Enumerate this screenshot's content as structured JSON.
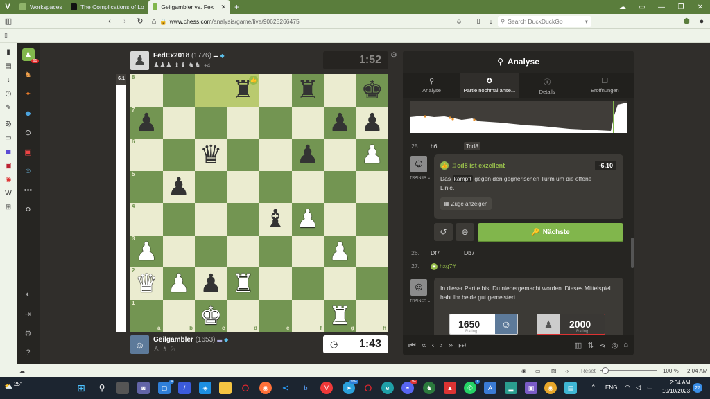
{
  "browser": {
    "tabs": [
      {
        "label": "Workspaces",
        "active": false
      },
      {
        "label": "The Complications of Long",
        "active": false
      },
      {
        "label": "Geilgambler vs. FexEx2018",
        "active": true
      }
    ],
    "url_host": "www.chess.com",
    "url_path": "/analysis/game/live/90625266475",
    "search_placeholder": "Search DuckDuckGo",
    "zoom_reset": "Reset",
    "zoom_value": "100 %",
    "zoom_level": 0.1,
    "status_time": "2:04 AM"
  },
  "nav": {
    "notification_count": "61"
  },
  "game": {
    "top_player": {
      "name": "FedEx2018",
      "rating": "(1776)",
      "captured": "♟♟♟ ♝♝ ♞♞",
      "advantage": "+4",
      "clock": "1:52"
    },
    "bottom_player": {
      "name": "Geilgambler",
      "rating": "(1653)",
      "captured": "♙ ♗ ♘",
      "clock": "1:43"
    },
    "eval_bar": {
      "label": "6.1",
      "white_fraction": 0.96
    },
    "files": [
      "a",
      "b",
      "c",
      "d",
      "e",
      "f",
      "g",
      "h"
    ],
    "ranks": [
      "8",
      "7",
      "6",
      "5",
      "4",
      "3",
      "2",
      "1"
    ],
    "board": [
      [
        "",
        "",
        "",
        "bR",
        "",
        "bR",
        "",
        "bK"
      ],
      [
        "bP",
        "",
        "",
        "",
        "",
        "",
        "bP",
        "bP"
      ],
      [
        "",
        "",
        "bQ",
        "",
        "",
        "bP",
        "",
        "wP"
      ],
      [
        "",
        "bP",
        "",
        "",
        "",
        "",
        "",
        ""
      ],
      [
        "",
        "",
        "",
        "",
        "bB",
        "wP",
        "",
        ""
      ],
      [
        "wP",
        "",
        "",
        "",
        "",
        "",
        "wP",
        ""
      ],
      [
        "wQ",
        "wP",
        "bP",
        "wR",
        "",
        "",
        "",
        ""
      ],
      [
        "",
        "",
        "wK",
        "",
        "",
        "",
        "wR",
        ""
      ]
    ],
    "highlight": [
      [
        0,
        2
      ],
      [
        0,
        3
      ]
    ],
    "badge_square": [
      0,
      3
    ]
  },
  "analysis": {
    "title": "Analyse",
    "tabs": [
      "Analyse",
      "Partie nochmal anse...",
      "Details",
      "Eröffnungen"
    ],
    "active_tab": 1,
    "moves": [
      {
        "num": "25.",
        "white": "h6",
        "black": "Tcd8"
      },
      {
        "num": "26.",
        "white": "Df7",
        "black": "Db7"
      },
      {
        "num": "27.",
        "white": "hxg7#",
        "black": ""
      }
    ],
    "coach_label": "TRAINER ⌄",
    "feedback": {
      "move_text": "♖cd8 ist exzellent",
      "score": "-6.10",
      "text_before": "Das",
      "keyword": "kämpft",
      "text_after": "gegen den gegnerischen Turm um die offene Linie.",
      "show_moves": "Züge anzeigen"
    },
    "next_button": "Nächste",
    "summary": "In dieser Partie bist Du niedergemacht worden. Dieses Mittelspiel habt Ihr beide gut gemeistert.",
    "ratings": [
      {
        "value": "1650",
        "label": "Rating"
      },
      {
        "value": "2000",
        "label": "Rating"
      }
    ]
  },
  "taskbar": {
    "weather": "25°",
    "lang": "ENG",
    "time": "2:04 AM",
    "date": "10/10/2023",
    "notif": "27",
    "badges": {
      "whatsapp": "4",
      "telegram": "99+",
      "discord": "9+",
      "other": "1"
    }
  },
  "colors": {
    "board_light": "#ebecd0",
    "board_dark": "#739552",
    "accent": "#81b64c",
    "good": "#96bc4b"
  }
}
